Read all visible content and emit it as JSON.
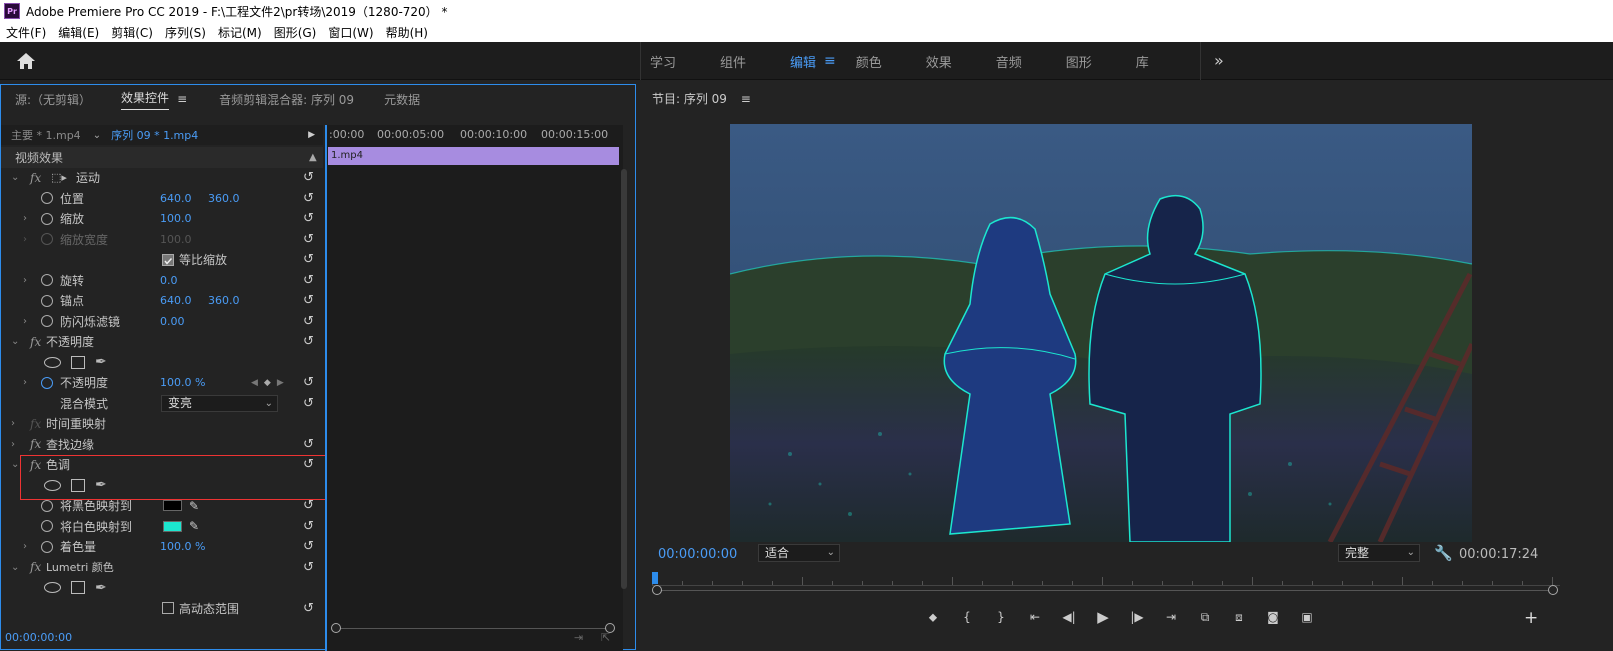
{
  "window": {
    "title": "Adobe Premiere Pro CC 2019 - F:\\工程文件2\\pr转场\\2019（1280-720）  *",
    "logo": "Pr"
  },
  "menu": [
    "文件(F)",
    "编辑(E)",
    "剪辑(C)",
    "序列(S)",
    "标记(M)",
    "图形(G)",
    "窗口(W)",
    "帮助(H)"
  ],
  "workspaces": [
    {
      "label": "学习",
      "active": false
    },
    {
      "label": "组件",
      "active": false
    },
    {
      "label": "编辑",
      "active": true
    },
    {
      "label": "颜色",
      "active": false
    },
    {
      "label": "效果",
      "active": false
    },
    {
      "label": "音频",
      "active": false
    },
    {
      "label": "图形",
      "active": false
    },
    {
      "label": "库",
      "active": false
    }
  ],
  "left_panel": {
    "tabs": [
      "源:（无剪辑）",
      "效果控件",
      "音频剪辑混合器: 序列 09",
      "元数据"
    ],
    "active_tab": "效果控件",
    "header": {
      "master": "主要 * 1.mp4",
      "sequence": "序列 09 * 1.mp4"
    },
    "timeline": {
      "ruler": [
        ":00:00",
        "00:00:05:00",
        "00:00:10:00",
        "00:00:15:00"
      ],
      "clip": "1.mp4"
    },
    "section": "视频效果",
    "rows": {
      "motion": "运动",
      "position": {
        "label": "位置",
        "x": "640.0",
        "y": "360.0"
      },
      "scale": {
        "label": "缩放",
        "value": "100.0"
      },
      "scale_width": {
        "label": "缩放宽度",
        "value": "100.0"
      },
      "uniform_scale": "等比缩放",
      "rotation": {
        "label": "旋转",
        "value": "0.0"
      },
      "anchor": {
        "label": "锚点",
        "x": "640.0",
        "y": "360.0"
      },
      "anti_flicker": {
        "label": "防闪烁滤镜",
        "value": "0.00"
      },
      "opacity_group": "不透明度",
      "opacity": {
        "label": "不透明度",
        "value": "100.0 %"
      },
      "blend_mode": {
        "label": "混合模式",
        "value": "变亮"
      },
      "time_remap": "时间重映射",
      "find_edges": "查找边缘",
      "tint": "色调",
      "map_black": "将黑色映射到",
      "map_white": "将白色映射到",
      "tint_amount": {
        "label": "着色量",
        "value": "100.0 %"
      },
      "lumetri": "Lumetri 颜色",
      "hdr": "高动态范围"
    },
    "bottom_time": "00:00:00:00"
  },
  "program": {
    "title": "节目: 序列 09",
    "timecode": "00:00:00:00",
    "fit": "适合",
    "quality": "完整",
    "duration": "00:00:17:24"
  },
  "colors": {
    "accent": "#4a9cf6",
    "clip": "#a78ce0",
    "white_map": "#1ce6cf",
    "black_map": "#000000",
    "highlight": "#e33333"
  }
}
